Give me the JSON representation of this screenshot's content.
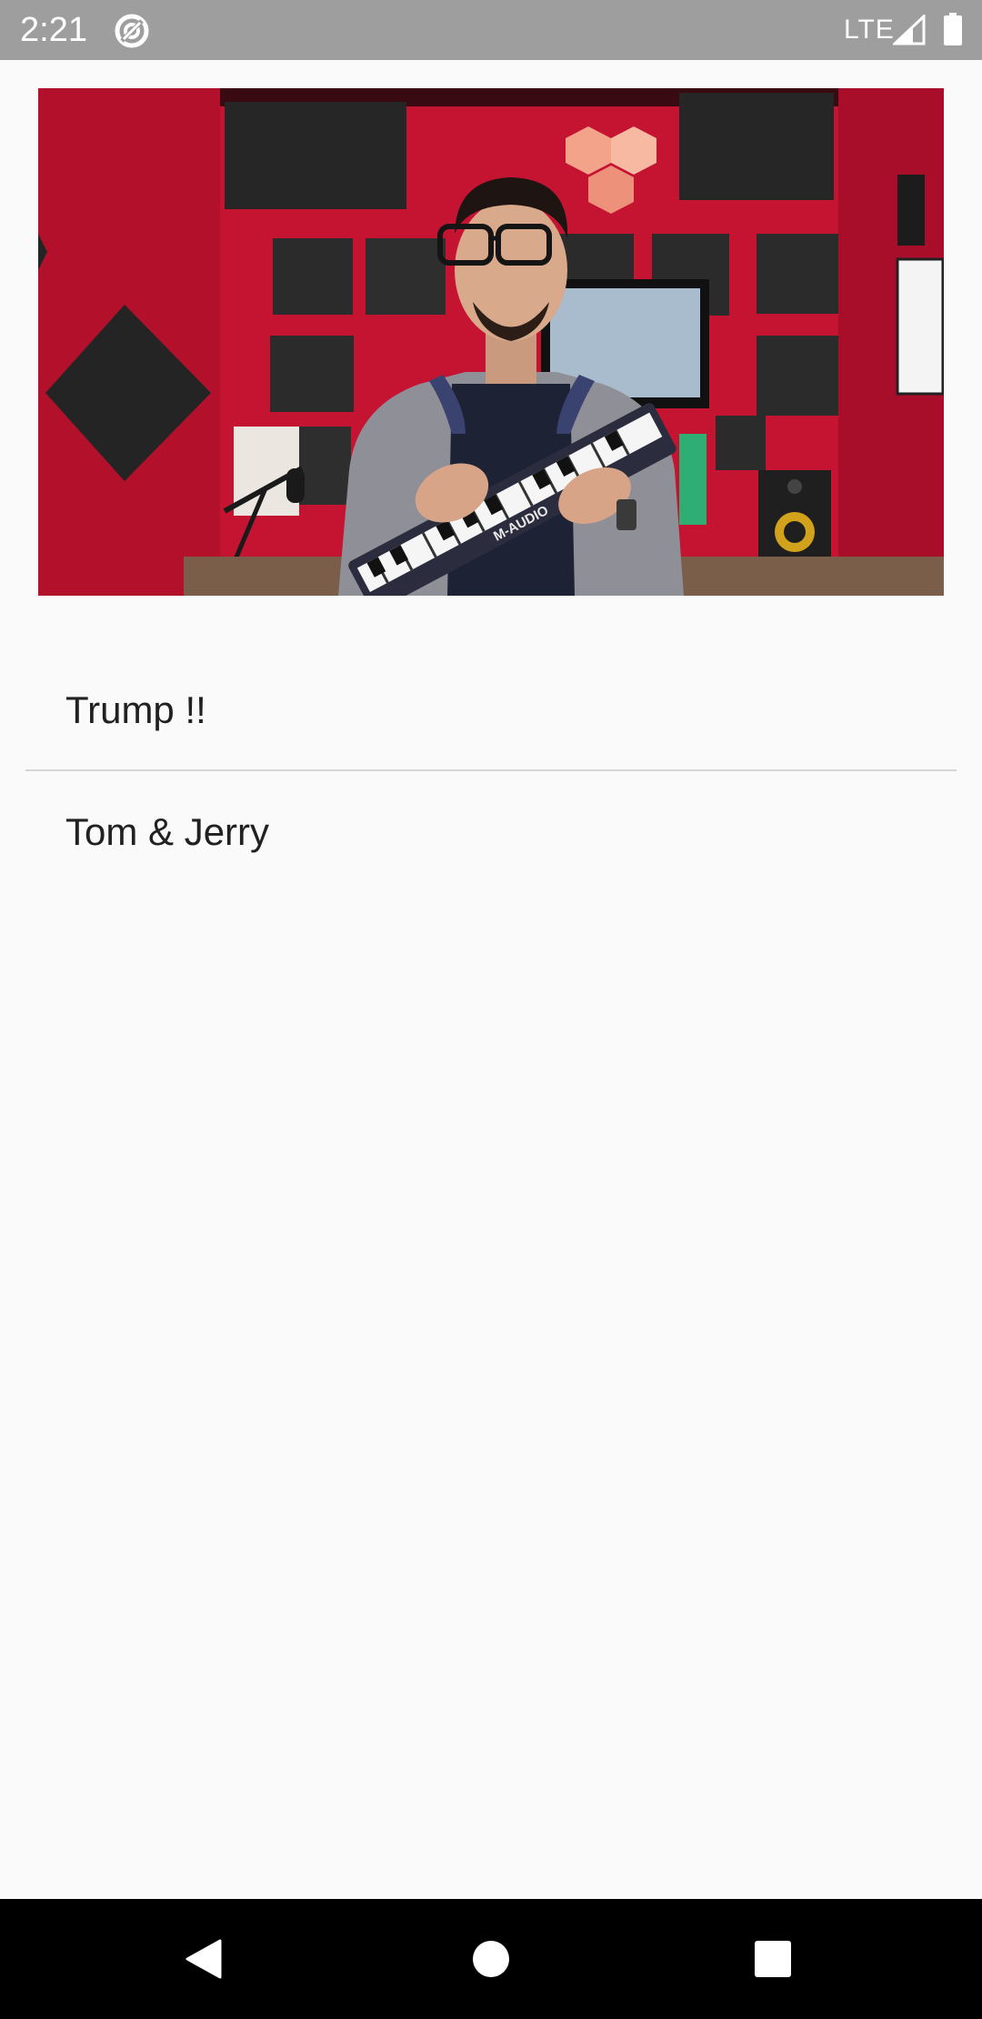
{
  "status_bar": {
    "time": "2:21",
    "network": "LTE",
    "icons": [
      "sync-icon",
      "signal-icon",
      "battery-icon"
    ],
    "background": "#9e9e9e"
  },
  "video": {
    "thumbnail_icon": "video-thumbnail",
    "keyboard_brand": "M-AUDIO"
  },
  "list": {
    "items": [
      {
        "label": "Trump !!"
      },
      {
        "label": "Tom & Jerry"
      }
    ]
  },
  "nav_bar": {
    "icons": [
      "back-icon",
      "home-icon",
      "recents-icon"
    ]
  },
  "colors": {
    "page_background": "#fafafa",
    "text": "#212121",
    "divider": "#d6d6d6",
    "studio_red": "#c41432"
  }
}
